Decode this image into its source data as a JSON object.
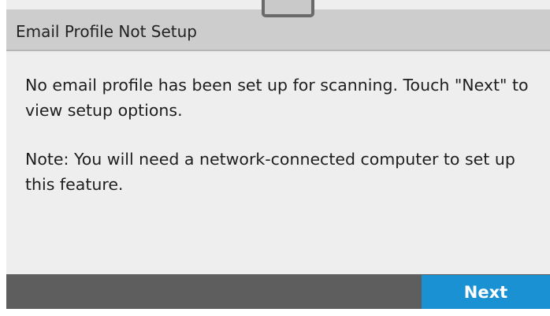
{
  "dialog": {
    "title": "Email Profile Not Setup",
    "message": "No email profile has been set up for scanning. Touch \"Next\" to view setup options.",
    "note": "Note: You will need a network-connected computer to set up this feature."
  },
  "footer": {
    "next_label": "Next"
  },
  "colors": {
    "accent": "#1a91d3",
    "footer_bg": "#5e5e5e",
    "title_bg": "#cdcdcd",
    "panel_bg": "#eeeeee"
  }
}
